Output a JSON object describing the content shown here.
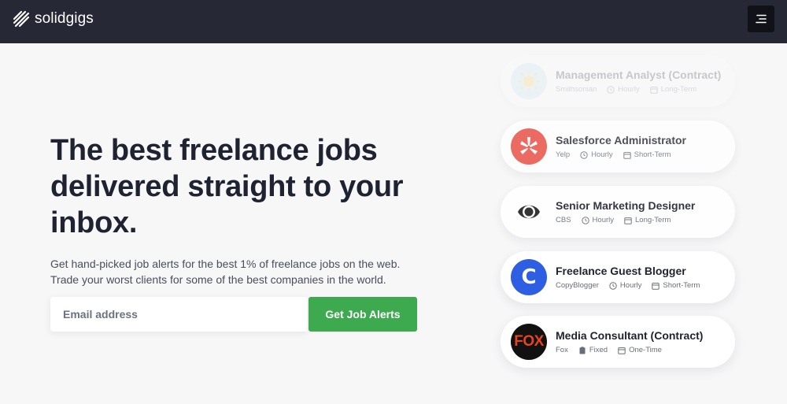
{
  "header": {
    "brand": "solidgigs",
    "menu_icon": "menu-icon"
  },
  "hero": {
    "title": "The best freelance jobs delivered straight to your inbox.",
    "subtitle": "Get hand-picked job alerts for the best 1% of freelance jobs on the web. Trade your worst clients for some of the best companies in the world."
  },
  "signup": {
    "email_placeholder": "Email address",
    "button_label": "Get Job Alerts",
    "button_color": "#3daa4f"
  },
  "jobs": [
    {
      "title": "Management Analyst (Contract)",
      "company": "Smithsonian",
      "rate": "Hourly",
      "rate_icon": "clock-icon",
      "term": "Long-Term",
      "logo": "smithsonian-logo"
    },
    {
      "title": "Salesforce Administrator",
      "company": "Yelp",
      "rate": "Hourly",
      "rate_icon": "clock-icon",
      "term": "Short-Term",
      "logo": "yelp-logo"
    },
    {
      "title": "Senior Marketing Designer",
      "company": "CBS",
      "rate": "Hourly",
      "rate_icon": "clock-icon",
      "term": "Long-Term",
      "logo": "cbs-logo"
    },
    {
      "title": "Freelance Guest Blogger",
      "company": "CopyBlogger",
      "rate": "Hourly",
      "rate_icon": "clock-icon",
      "term": "Short-Term",
      "logo": "copyblogger-logo"
    },
    {
      "title": "Media Consultant (Contract)",
      "company": "Fox",
      "rate": "Fixed",
      "rate_icon": "clipboard-icon",
      "term": "One-Time",
      "logo": "fox-logo"
    }
  ],
  "colors": {
    "header_bg": "#262835",
    "page_bg": "#f7f7f8",
    "accent_green": "#3daa4f"
  }
}
